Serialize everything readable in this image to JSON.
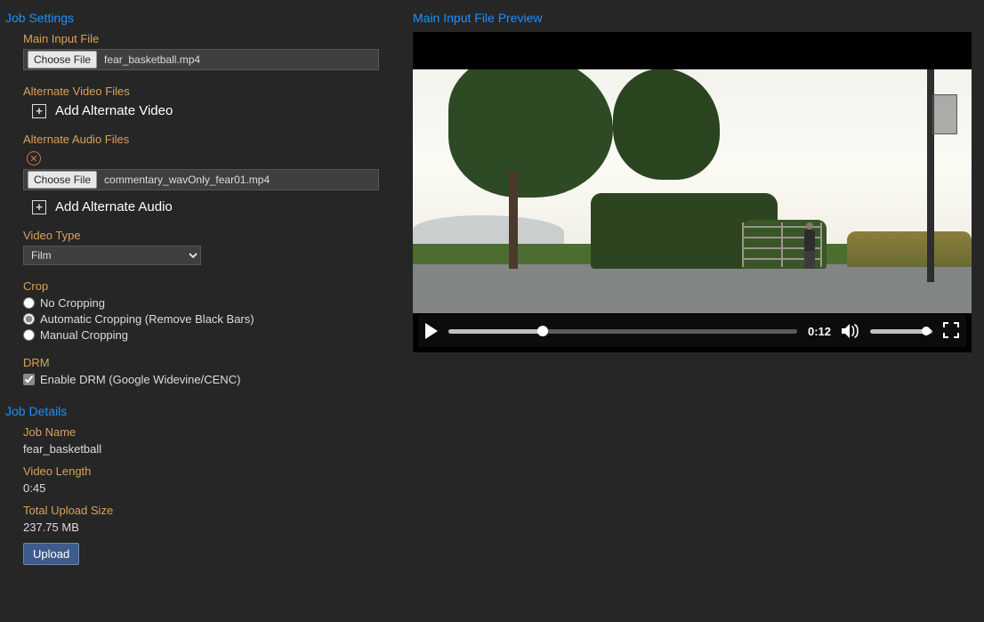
{
  "job_settings": {
    "title": "Job Settings",
    "main_input": {
      "label": "Main Input File",
      "choose_btn": "Choose File",
      "filename": "fear_basketball.mp4"
    },
    "alt_video": {
      "label": "Alternate Video Files",
      "add_label": "Add Alternate Video"
    },
    "alt_audio": {
      "label": "Alternate Audio Files",
      "choose_btn": "Choose File",
      "filename": "commentary_wavOnly_fear01.mp4",
      "add_label": "Add Alternate Audio"
    },
    "video_type": {
      "label": "Video Type",
      "selected": "Film"
    },
    "crop": {
      "label": "Crop",
      "options": {
        "none": "No Cropping",
        "auto": "Automatic Cropping (Remove Black Bars)",
        "manual": "Manual Cropping"
      },
      "selected": "auto"
    },
    "drm": {
      "label": "DRM",
      "checkbox_label": "Enable DRM (Google Widevine/CENC)",
      "checked": true
    }
  },
  "job_details": {
    "title": "Job Details",
    "name_label": "Job Name",
    "name_value": "fear_basketball",
    "length_label": "Video Length",
    "length_value": "0:45",
    "size_label": "Total Upload Size",
    "size_value": "237.75 MB",
    "upload_btn": "Upload"
  },
  "preview": {
    "title": "Main Input File Preview",
    "time": "0:12"
  }
}
